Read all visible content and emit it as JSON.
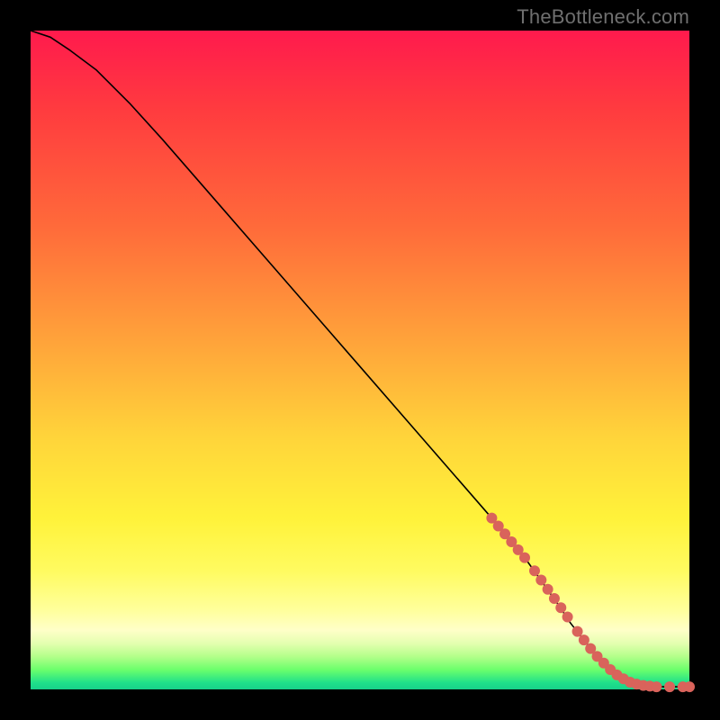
{
  "watermark": "TheBottleneck.com",
  "chart_data": {
    "type": "line",
    "title": "",
    "xlabel": "",
    "ylabel": "",
    "xlim": [
      0,
      100
    ],
    "ylim": [
      0,
      100
    ],
    "grid": false,
    "legend": false,
    "series": [
      {
        "name": "curve",
        "x": [
          0,
          3,
          6,
          10,
          15,
          20,
          30,
          40,
          50,
          60,
          70,
          75,
          80,
          82,
          84,
          86,
          88,
          90,
          92,
          94,
          96,
          98,
          100
        ],
        "y": [
          100,
          99,
          97,
          94,
          89,
          83.5,
          72,
          60.5,
          49,
          37.5,
          26,
          20,
          13,
          10,
          7.5,
          5,
          3,
          1.6,
          0.8,
          0.5,
          0.4,
          0.4,
          0.4
        ]
      }
    ],
    "markers": [
      {
        "x": 70,
        "y": 26
      },
      {
        "x": 71,
        "y": 24.8
      },
      {
        "x": 72,
        "y": 23.6
      },
      {
        "x": 73,
        "y": 22.4
      },
      {
        "x": 74,
        "y": 21.2
      },
      {
        "x": 75,
        "y": 20
      },
      {
        "x": 76.5,
        "y": 18
      },
      {
        "x": 77.5,
        "y": 16.6
      },
      {
        "x": 78.5,
        "y": 15.2
      },
      {
        "x": 79.5,
        "y": 13.8
      },
      {
        "x": 80.5,
        "y": 12.4
      },
      {
        "x": 81.5,
        "y": 11
      },
      {
        "x": 83,
        "y": 8.8
      },
      {
        "x": 84,
        "y": 7.5
      },
      {
        "x": 85,
        "y": 6.2
      },
      {
        "x": 86,
        "y": 5
      },
      {
        "x": 87,
        "y": 4
      },
      {
        "x": 88,
        "y": 3
      },
      {
        "x": 89,
        "y": 2.2
      },
      {
        "x": 90,
        "y": 1.6
      },
      {
        "x": 91,
        "y": 1.1
      },
      {
        "x": 92,
        "y": 0.8
      },
      {
        "x": 93,
        "y": 0.6
      },
      {
        "x": 94,
        "y": 0.5
      },
      {
        "x": 95,
        "y": 0.4
      },
      {
        "x": 97,
        "y": 0.4
      },
      {
        "x": 99,
        "y": 0.4
      },
      {
        "x": 100,
        "y": 0.4
      }
    ],
    "background_gradient": {
      "top": "#ff1a4d",
      "mid": "#ffd53a",
      "bottom": "#18d08a"
    }
  }
}
